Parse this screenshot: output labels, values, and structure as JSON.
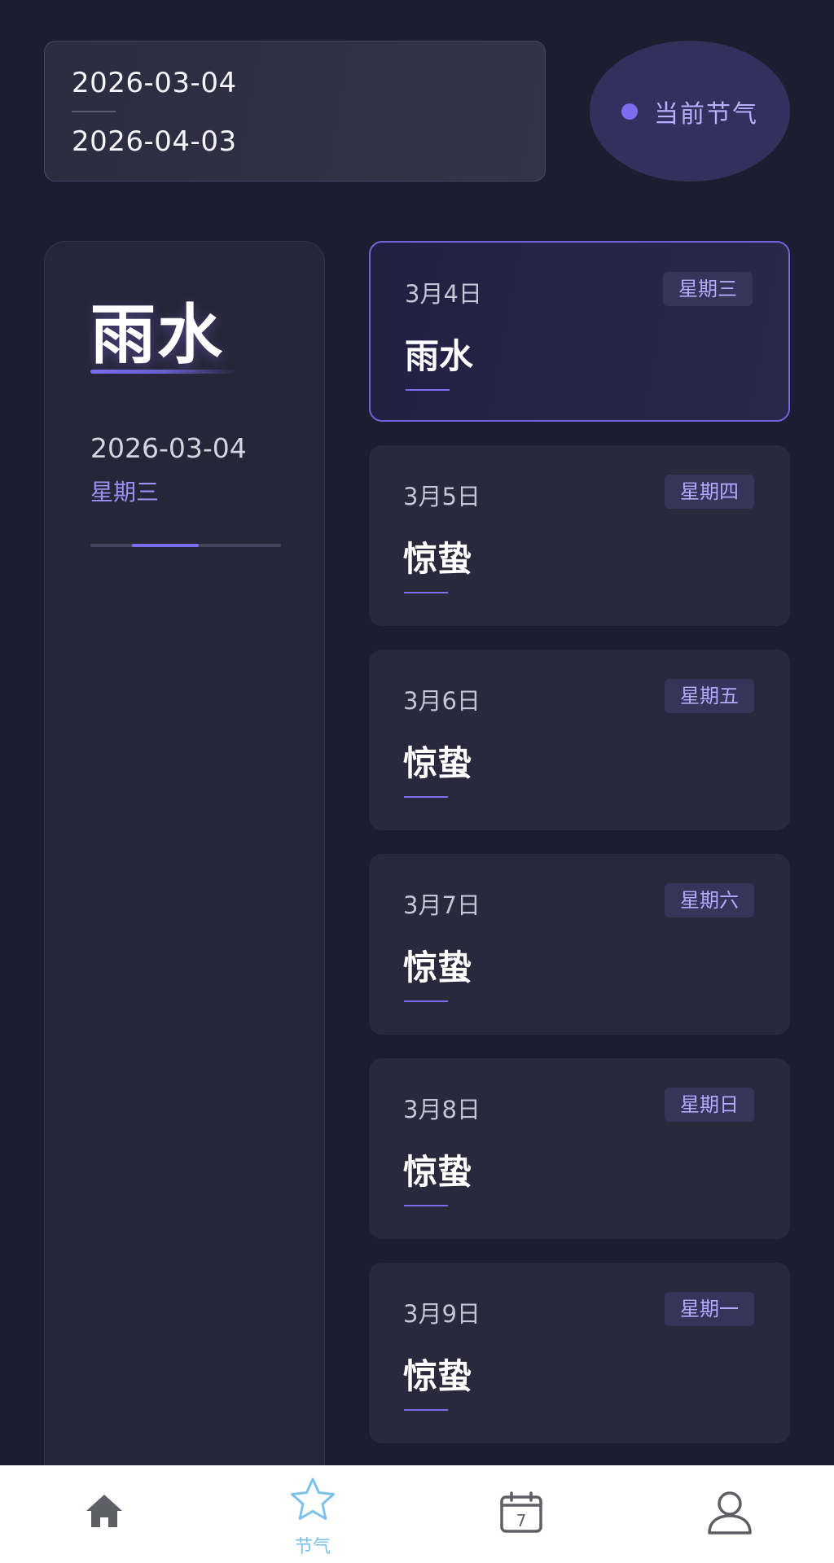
{
  "range": {
    "start": "2026-03-04",
    "end": "2026-04-03"
  },
  "current_term_button": {
    "label": "当前节气"
  },
  "summary": {
    "term": "雨水",
    "date": "2026-03-04",
    "weekday": "星期三",
    "progress": {
      "start": 0.22,
      "end": 0.57
    }
  },
  "days": [
    {
      "date": "3月4日",
      "weekday": "星期三",
      "term": "雨水",
      "active": true
    },
    {
      "date": "3月5日",
      "weekday": "星期四",
      "term": "惊蛰",
      "active": false
    },
    {
      "date": "3月6日",
      "weekday": "星期五",
      "term": "惊蛰",
      "active": false
    },
    {
      "date": "3月7日",
      "weekday": "星期六",
      "term": "惊蛰",
      "active": false
    },
    {
      "date": "3月8日",
      "weekday": "星期日",
      "term": "惊蛰",
      "active": false
    },
    {
      "date": "3月9日",
      "weekday": "星期一",
      "term": "惊蛰",
      "active": false
    }
  ],
  "tabbar": {
    "items": [
      {
        "icon": "home-icon",
        "label": "",
        "active": false
      },
      {
        "icon": "star-icon",
        "label": "节气",
        "active": true
      },
      {
        "icon": "calendar-icon",
        "label": "",
        "active": false,
        "calendar_number": "7"
      },
      {
        "icon": "user-icon",
        "label": "",
        "active": false
      }
    ]
  },
  "colors": {
    "background": "#1d1d2f",
    "accent": "#7b6cf0",
    "accent_text": "#b6a9ff",
    "tab_active": "#7cc0ec",
    "tab_inactive": "#5e5e66"
  }
}
